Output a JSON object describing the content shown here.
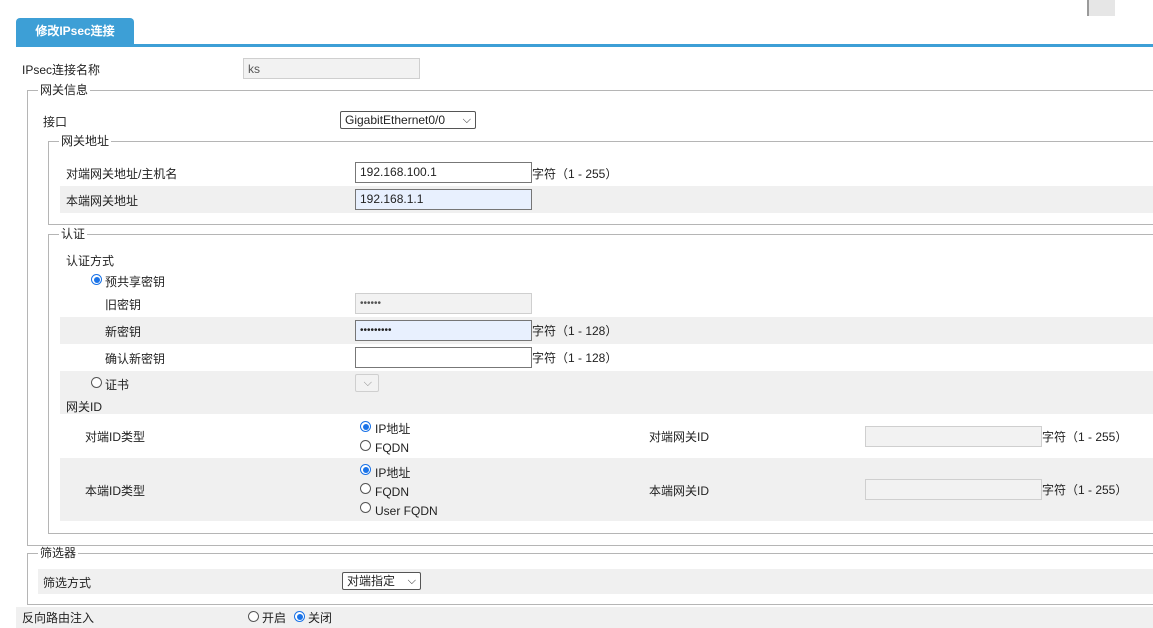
{
  "tab": {
    "label": "修改IPsec连接"
  },
  "conn_name": {
    "label": "IPsec连接名称",
    "value": "ks"
  },
  "gateway_info": {
    "legend": "网关信息",
    "interface_label": "接口",
    "interface_value": "GigabitEthernet0/0",
    "gateway_address": {
      "legend": "网关地址",
      "peer_label": "对端网关地址/主机名",
      "peer_value": "192.168.100.1",
      "peer_hint": "字符（1 - 255）",
      "local_label": "本端网关地址",
      "local_value": "192.168.1.1"
    }
  },
  "auth": {
    "legend": "认证",
    "method_label": "认证方式",
    "psk_label": "预共享密钥",
    "old_key_label": "旧密钥",
    "old_key_value": "••••••",
    "new_key_label": "新密钥",
    "new_key_value": "•••••••••",
    "new_key_hint": "字符（1 - 128）",
    "confirm_key_label": "确认新密钥",
    "confirm_key_value": "",
    "confirm_key_hint": "字符（1 - 128）",
    "cert_label": "证书",
    "gateway_id_label": "网关ID",
    "peer_id_type_label": "对端ID类型",
    "peer_id_options": [
      "IP地址",
      "FQDN"
    ],
    "peer_gw_id_label": "对端网关ID",
    "peer_gw_id_hint": "字符（1 - 255）",
    "local_id_type_label": "本端ID类型",
    "local_id_options": [
      "IP地址",
      "FQDN",
      "User FQDN"
    ],
    "local_gw_id_label": "本端网关ID",
    "local_gw_id_hint": "字符（1 - 255）"
  },
  "filter": {
    "legend": "筛选器",
    "method_label": "筛选方式",
    "method_value": "对端指定"
  },
  "rri": {
    "label": "反向路由注入",
    "on_label": "开启",
    "off_label": "关闭"
  },
  "colors": {
    "accent": "#3d9fd6",
    "radio_selected": "#1a73e8",
    "row_shade": "#f0f0f0"
  }
}
